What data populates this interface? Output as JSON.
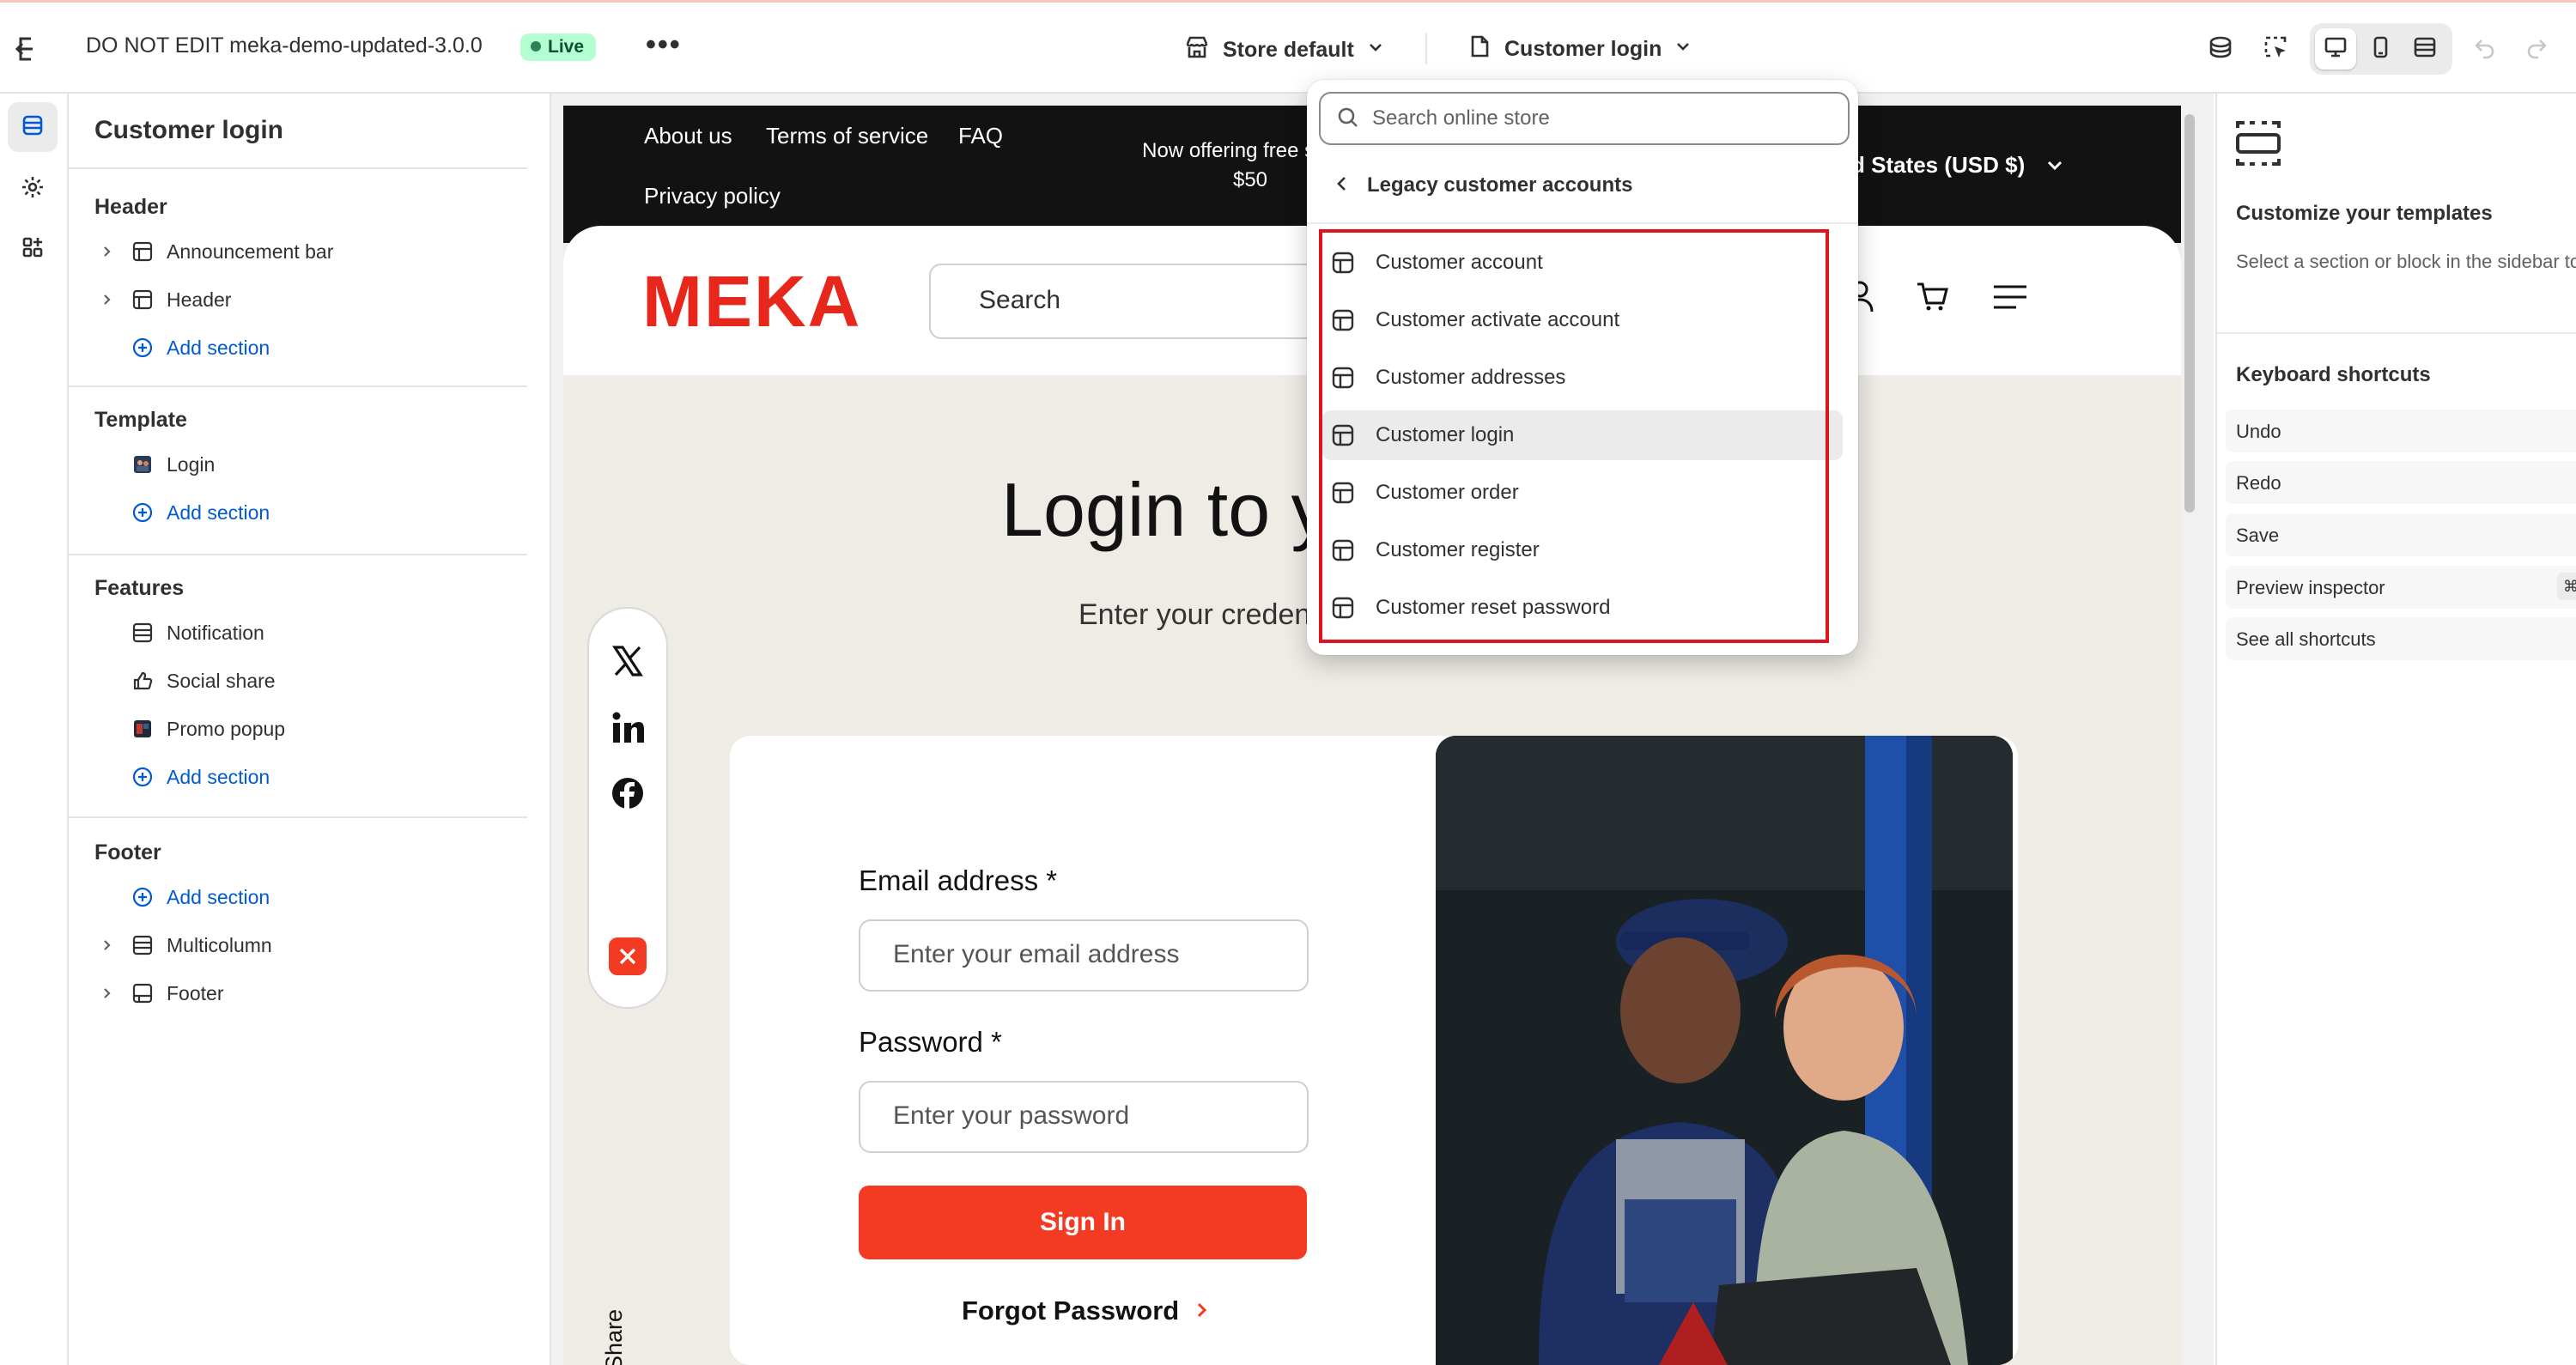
{
  "topbar": {
    "store_title": "DO NOT EDIT meka-demo-updated-3.0.0",
    "live_badge": "Live",
    "more": "•••",
    "store_selector": "Store default",
    "template_selector": "Customer login"
  },
  "sidebar": {
    "title": "Customer login",
    "groups": [
      {
        "heading": "Header",
        "items": [
          {
            "label": "Announcement bar"
          },
          {
            "label": "Header"
          }
        ],
        "add": "Add section"
      },
      {
        "heading": "Template",
        "items": [
          {
            "label": "Login"
          }
        ],
        "add": "Add section"
      },
      {
        "heading": "Features",
        "items": [
          {
            "label": "Notification"
          },
          {
            "label": "Social share"
          },
          {
            "label": "Promo popup"
          }
        ],
        "add": "Add section"
      },
      {
        "heading": "Footer",
        "add": "Add section",
        "items": [
          {
            "label": "Multicolumn"
          },
          {
            "label": "Footer"
          }
        ]
      }
    ]
  },
  "preview": {
    "announcement": {
      "links": [
        "About us",
        "Terms of service",
        "FAQ",
        "Privacy policy"
      ],
      "center_line1": "Now offering free shippi",
      "center_line2": "$50",
      "currency": "d States (USD $)"
    },
    "logo": "MEKA",
    "search_placeholder": "Search",
    "heading": "Login to y",
    "subheading": "Enter your creden",
    "share_label": "Share",
    "form": {
      "email_label": "Email address *",
      "email_placeholder": "Enter your email address",
      "password_label": "Password *",
      "password_placeholder": "Enter your password",
      "signin": "Sign In",
      "forgot": "Forgot Password"
    }
  },
  "dropdown": {
    "search_placeholder": "Search online store",
    "back_label": "Legacy customer accounts",
    "items": [
      {
        "label": "Customer account"
      },
      {
        "label": "Customer activate account"
      },
      {
        "label": "Customer addresses"
      },
      {
        "label": "Customer login",
        "selected": true
      },
      {
        "label": "Customer order"
      },
      {
        "label": "Customer register"
      },
      {
        "label": "Customer reset password"
      }
    ],
    "highlight_color": "#e0141b"
  },
  "right_panel": {
    "title": "Customize your templates",
    "description": "Select a section or block in the sidebar to start.",
    "shortcuts_heading": "Keyboard shortcuts",
    "shortcuts": [
      "Undo",
      "Redo",
      "Save",
      "Preview inspector",
      "See all shortcuts"
    ],
    "preview_inspector_key": "⌘"
  },
  "colors": {
    "accent_blue": "#005bd3",
    "brand_red": "#e8271c",
    "button_red": "#f33a22",
    "live_green": "#b4fed2"
  }
}
